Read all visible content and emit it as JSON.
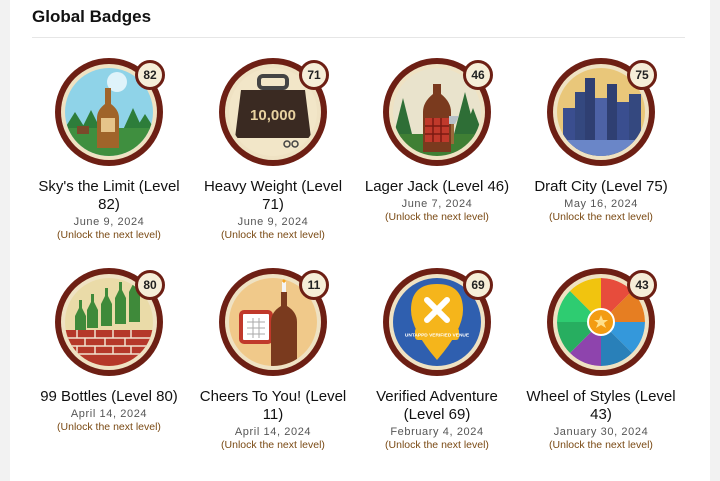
{
  "section_title": "Global Badges",
  "badges": [
    {
      "name": "Sky's the Limit (Level 82)",
      "level": "82",
      "date": "June 9, 2024",
      "unlock": "(Unlock the next level)"
    },
    {
      "name": "Heavy Weight (Level 71)",
      "level": "71",
      "date": "June 9, 2024",
      "unlock": "(Unlock the next level)"
    },
    {
      "name": "Lager Jack (Level 46)",
      "level": "46",
      "date": "June 7, 2024",
      "unlock": "(Unlock the next level)"
    },
    {
      "name": "Draft City (Level 75)",
      "level": "75",
      "date": "May 16, 2024",
      "unlock": "(Unlock the next level)"
    },
    {
      "name": "99 Bottles (Level 80)",
      "level": "80",
      "date": "April 14, 2024",
      "unlock": "(Unlock the next level)"
    },
    {
      "name": "Cheers To You! (Level 11)",
      "level": "11",
      "date": "April 14, 2024",
      "unlock": "(Unlock the next level)"
    },
    {
      "name": "Verified Adventure (Level 69)",
      "level": "69",
      "date": "February 4, 2024",
      "unlock": "(Unlock the next level)",
      "image_text": "UNTAPPD VERIFIED VENUE"
    },
    {
      "name": "Wheel of Styles (Level 43)",
      "level": "43",
      "date": "January 30, 2024",
      "unlock": "(Unlock the next level)"
    }
  ],
  "heavy_weight_image_text": "10,000",
  "colors": {
    "ring": "#6d1f14",
    "unlock_text": "#7a4a14"
  }
}
